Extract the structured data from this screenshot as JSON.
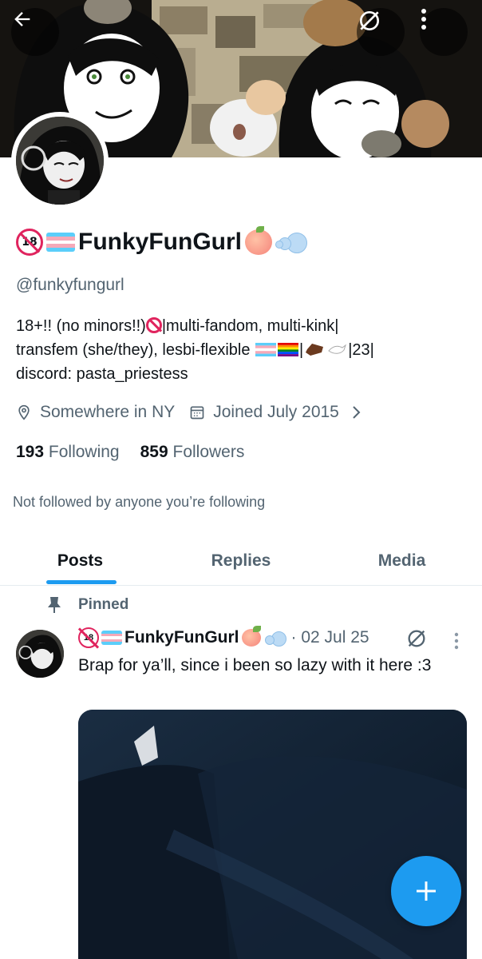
{
  "profile": {
    "display_name": "FunkyFunGurl",
    "handle": "@funkyfungurl",
    "bio_line1": "18+!! (no minors!!)",
    "bio_line1b": "|multi-fandom, multi-kink|",
    "bio_line2": "transfem (she/they), lesbi-flexible",
    "bio_line2b": "|",
    "bio_line2c": "|23|",
    "bio_line3": "discord: pasta_priestess",
    "location": "Somewhere in NY",
    "joined": "Joined July 2015",
    "following_count": "193",
    "following_label": "Following",
    "followers_count": "859",
    "followers_label": "Followers",
    "not_followed": "Not followed by anyone you’re following"
  },
  "tabs": [
    {
      "label": "Posts",
      "active": true
    },
    {
      "label": "Replies",
      "active": false
    },
    {
      "label": "Media",
      "active": false
    }
  ],
  "pinned_post": {
    "pinned_label": "Pinned",
    "author": "FunkyFunGurl",
    "date": "· 02 Jul 25",
    "text": "Brap for ya’ll, since i been so lazy with it here :3"
  },
  "badge_text": "18",
  "colors": {
    "accent": "#1d9bf0",
    "text_primary": "#0f1419",
    "text_secondary": "#536471"
  },
  "icons": {
    "back": "arrow-left-icon",
    "grok": "grok-icon",
    "more": "more-vertical-icon",
    "location": "location-pin-icon",
    "calendar": "calendar-icon",
    "pin": "pin-icon",
    "compose": "plus-icon"
  }
}
